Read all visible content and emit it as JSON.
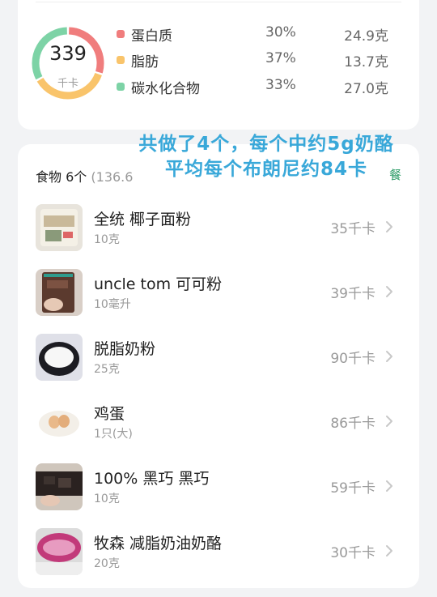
{
  "summary": {
    "kcal": "339",
    "kcal_unit": "千卡",
    "macros": [
      {
        "name": "蛋白质",
        "percent": "30%",
        "amount": "24.9克",
        "color": "#f07d7d",
        "share": 0.3
      },
      {
        "name": "脂肪",
        "percent": "37%",
        "amount": "13.7克",
        "color": "#f9c46b",
        "share": 0.37
      },
      {
        "name": "碳水化合物",
        "percent": "33%",
        "amount": "27.0克",
        "color": "#7dd3a6",
        "share": 0.33
      }
    ]
  },
  "list": {
    "title": "食物",
    "count": "6个",
    "total_partial": "(136.6",
    "meal_suffix": "餐"
  },
  "annotation": {
    "line1": "共做了4个，每个中约5g奶酪",
    "line2": "平均每个布朗尼约84卡"
  },
  "foods": [
    {
      "name": "全统 椰子面粉",
      "qty": "10克",
      "kcal": "35千卡",
      "icon": "flour-bag-photo"
    },
    {
      "name": "uncle tom 可可粉",
      "qty": "10毫升",
      "kcal": "39千卡",
      "icon": "cocoa-powder-bag-photo"
    },
    {
      "name": "脱脂奶粉",
      "qty": "25克",
      "kcal": "90千卡",
      "icon": "milk-powder-bowl-photo"
    },
    {
      "name": "鸡蛋",
      "qty": "1只(大)",
      "kcal": "86千卡",
      "icon": "eggs-plate-photo"
    },
    {
      "name": "100% 黑巧 黑巧",
      "qty": "10克",
      "kcal": "59千卡",
      "icon": "dark-chocolate-photo"
    },
    {
      "name": "牧森 减脂奶油奶酪",
      "qty": "20克",
      "kcal": "30千卡",
      "icon": "cream-cheese-tub-photo"
    }
  ]
}
